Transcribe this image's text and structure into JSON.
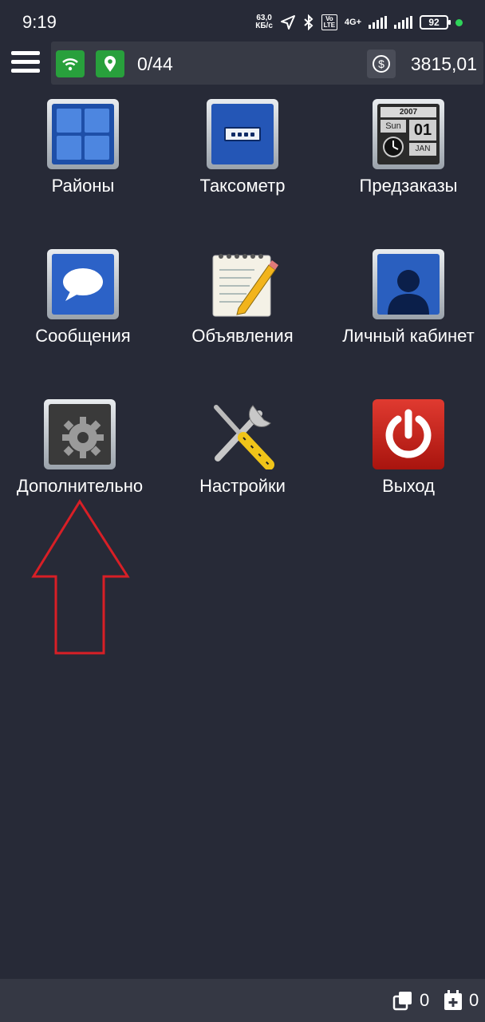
{
  "status_bar": {
    "time": "9:19",
    "speed_value": "63,0",
    "speed_unit": "КБ/с",
    "volte": "Vo LTE",
    "network": "4G+",
    "battery": "92"
  },
  "app_bar": {
    "counter": "0/44",
    "balance": "3815,01",
    "icons": [
      "menu-icon",
      "wifi-icon",
      "location-pin-icon",
      "dollar-coin-icon"
    ],
    "accent_color": "#28a03c"
  },
  "tiles": [
    {
      "label": "Районы",
      "icon": "districts-grid-icon"
    },
    {
      "label": "Таксометр",
      "icon": "taximeter-password-icon"
    },
    {
      "label": "Предзаказы",
      "icon": "calendar-clock-icon",
      "calendar": {
        "year": "2007",
        "day": "Sun",
        "date": "01",
        "month": "JAN"
      }
    },
    {
      "label": "Сообщения",
      "icon": "speech-bubble-icon"
    },
    {
      "label": "Объявления",
      "icon": "notepad-pencil-icon"
    },
    {
      "label": "Личный кабинет",
      "icon": "user-silhouette-icon"
    },
    {
      "label": "Дополнительно",
      "icon": "gear-icon"
    },
    {
      "label": "Настройки",
      "icon": "tools-icon"
    },
    {
      "label": "Выход",
      "icon": "power-icon"
    }
  ],
  "bottom_bar": {
    "orders_count": "0",
    "added_count": "0"
  },
  "annotation": {
    "arrow_color": "#d81f26"
  }
}
